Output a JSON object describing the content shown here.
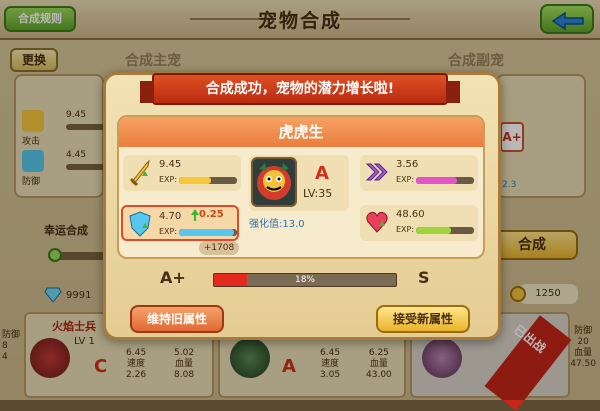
{
  "header": {
    "title": "宠物合成",
    "rules_label": "合成规则"
  },
  "background": {
    "swap_label": "更换",
    "main_pet_label": "合成主宠",
    "sub_pet_label": "合成副宠",
    "main_stats": [
      {
        "value": "9.45",
        "caption": "攻击"
      },
      {
        "value": "4.45",
        "caption": "防御"
      }
    ],
    "sub_grade": "A+",
    "sub_number": "2.3",
    "luck_label": "幸运合成",
    "fuse_label": "合成",
    "gems": "9991",
    "gold": "1250",
    "cards": [
      {
        "name": "火焰士兵",
        "lv": "LV 1",
        "grade": "C",
        "stats_a": "6.45\n速度\n2.26",
        "stats_b": "5.02\n血量\n8.08"
      },
      {
        "grade": "A",
        "stats_a": "6.45\n速度\n3.05",
        "stats_b": "6.25\n血量\n43.00"
      }
    ],
    "banner": "已出战",
    "side_stats": "防御\n20\n血量\n47.50",
    "left_stats": "防御\n8\n4"
  },
  "modal": {
    "ribbon": "合成成功，宠物的潜力增长啦!",
    "pet_name": "虎虎生",
    "pet_grade": "A",
    "pet_level": "LV:35",
    "strength": "强化值:13.0",
    "exp_label": "EXP:",
    "stats": [
      {
        "value": "9.45",
        "icon": "sword-icon",
        "fill": 0.55,
        "color": "#f6c63b"
      },
      {
        "value": "4.70",
        "plus": "0.25",
        "icon": "shield-icon",
        "fill": 0.95,
        "color": "#58c7ee",
        "highlight": true
      },
      {
        "value": "3.56",
        "icon": "speed-icon",
        "fill": 0.7,
        "color": "#e054c8"
      },
      {
        "value": "48.60",
        "icon": "heart-icon",
        "fill": 0.6,
        "color": "#9fd43c"
      }
    ],
    "gain": "+1708",
    "grade_from": "A+",
    "grade_to": "S",
    "progress_percent": 18,
    "progress_label": "18%",
    "keep_label": "维持旧属性",
    "accept_label": "接受新属性"
  },
  "colors": {
    "accent_red": "#e42a1c",
    "accent_green": "#5ea52a",
    "gold": "#e9b42c"
  }
}
